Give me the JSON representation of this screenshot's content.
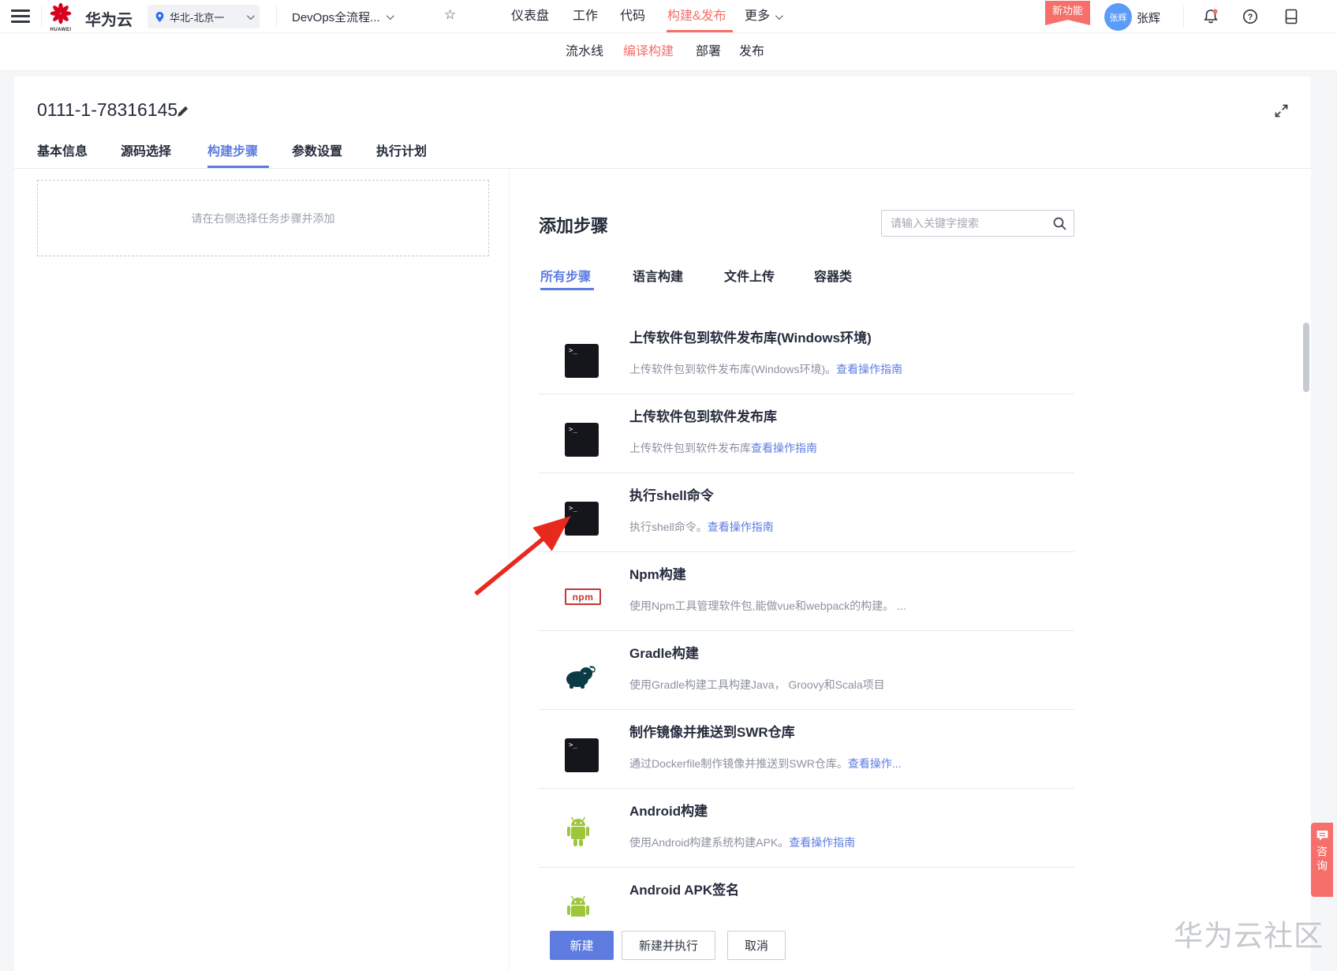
{
  "colors": {
    "accent_red": "#f66f6a",
    "accent_blue": "#5e7ce0",
    "link_blue": "#5e7ce0",
    "npm_red": "#c53635",
    "android_green": "#9dc63b",
    "gradle_teal": "#0b3c46",
    "arrow_red": "#e8291d",
    "text_dark": "#252b3a",
    "text_gray": "#8d92a0"
  },
  "topbar": {
    "brand": "华为云",
    "brand_sub": "HUAWEI",
    "region": "华北-北京一",
    "project": "DevOps全流程...",
    "nav": [
      "仪表盘",
      "工作",
      "代码",
      "构建&发布",
      "更多"
    ],
    "badge": "新功能",
    "avatar_text": "张辉",
    "username": "张辉"
  },
  "subnav": [
    "流水线",
    "编译构建",
    "部署",
    "发布"
  ],
  "build": {
    "title": "0111-1-78316145",
    "tabs": [
      "基本信息",
      "源码选择",
      "构建步骤",
      "参数设置",
      "执行计划"
    ],
    "dropzone_hint": "请在右侧选择任务步骤并添加",
    "panel_title": "添加步骤",
    "search_placeholder": "请输入关键字搜索",
    "step_tabs": [
      "所有步骤",
      "语言构建",
      "文件上传",
      "容器类"
    ],
    "terminal_prompt": ">_",
    "npm_label": "npm",
    "steps": [
      {
        "icon": "terminal-icon",
        "title": "上传软件包到软件发布库(Windows环境)",
        "desc": "上传软件包到软件发布库(Windows环境)。",
        "link": "查看操作指南"
      },
      {
        "icon": "terminal-icon",
        "title": "上传软件包到软件发布库",
        "desc": "上传软件包到软件发布库",
        "link": "查看操作指南"
      },
      {
        "icon": "terminal-icon",
        "title": "执行shell命令",
        "desc": "执行shell命令。",
        "link": "查看操作指南"
      },
      {
        "icon": "npm-icon",
        "title": "Npm构建",
        "desc": "使用Npm工具管理软件包,能做vue和webpack的构建。 ...",
        "link": ""
      },
      {
        "icon": "gradle-icon",
        "title": "Gradle构建",
        "desc": "使用Gradle构建工具构建Java， Groovy和Scala项目",
        "link": ""
      },
      {
        "icon": "terminal-icon",
        "title": "制作镜像并推送到SWR仓库",
        "desc": "通过Dockerfile制作镜像并推送到SWR仓库。",
        "link": "查看操作..."
      },
      {
        "icon": "android-icon",
        "title": "Android构建",
        "desc": "使用Android构建系统构建APK。",
        "link": "查看操作指南"
      },
      {
        "icon": "android-icon",
        "title": "Android APK签名",
        "desc": "",
        "link": ""
      }
    ],
    "footer": {
      "create": "新建",
      "create_run": "新建并执行",
      "cancel": "取消"
    }
  },
  "floating": {
    "consult": "咨询"
  },
  "watermark": "华为云社区"
}
